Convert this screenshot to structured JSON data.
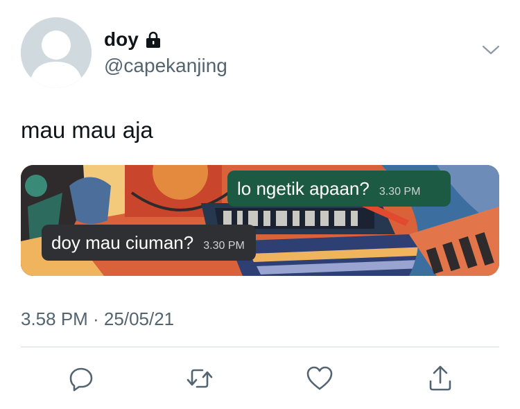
{
  "tweet": {
    "display_name": "doy",
    "handle": "@capekanjing",
    "text": "mau mau aja",
    "timestamp": "3.58 PM · 25/05/21",
    "protected_icon": "lock-icon",
    "menu_icon": "chevron-down-icon"
  },
  "media": {
    "chat": [
      {
        "text": "lo ngetik apaan?",
        "time": "3.30 PM",
        "direction": "outgoing",
        "color": "#1d5a44"
      },
      {
        "text": "doy mau ciuman?",
        "time": "3.30 PM",
        "direction": "incoming",
        "color": "#2f3033"
      }
    ]
  },
  "actions": {
    "icons": [
      "reply-icon",
      "retweet-icon",
      "like-icon",
      "share-icon"
    ],
    "color": "#536471"
  },
  "colors": {
    "secondary_text": "#536471",
    "primary_text": "#0f1419",
    "divider": "#cfd9de"
  }
}
